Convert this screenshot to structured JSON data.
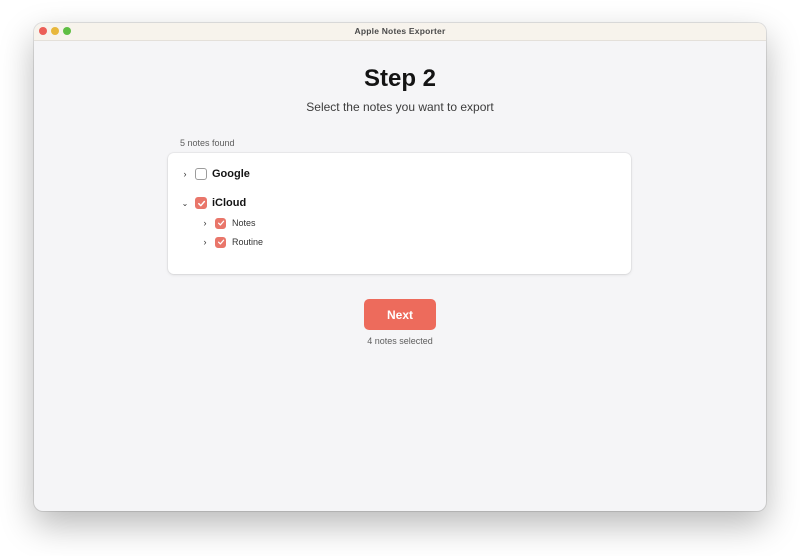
{
  "window": {
    "title": "Apple Notes Exporter"
  },
  "header": {
    "title": "Step 2",
    "subtitle": "Select the notes you want to export"
  },
  "tree": {
    "count_label": "5 notes found",
    "accounts": [
      {
        "label": "Google",
        "expanded": false,
        "checked": false,
        "folders": []
      },
      {
        "label": "iCloud",
        "expanded": true,
        "checked": true,
        "folders": [
          {
            "label": "Notes",
            "expanded": false,
            "checked": true
          },
          {
            "label": "Routine",
            "expanded": false,
            "checked": true
          }
        ]
      }
    ]
  },
  "footer": {
    "next_label": "Next",
    "selected_label": "4 notes selected"
  },
  "colors": {
    "accent": "#ed6b5c",
    "checkbox_checked": "#e9766a",
    "window_background": "#f5f5f7"
  }
}
